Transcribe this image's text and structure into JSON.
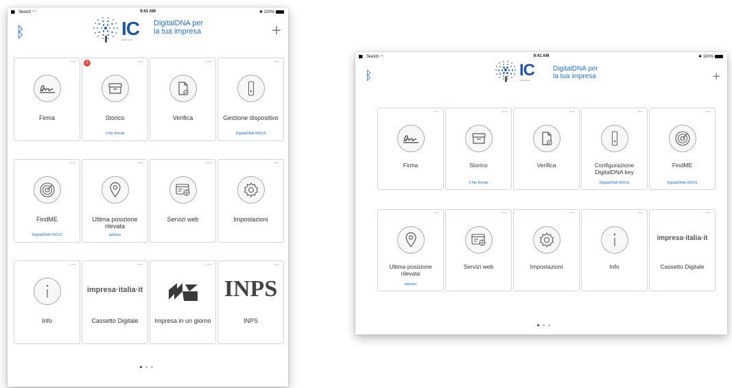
{
  "status_bar": {
    "carrier": "Sketch",
    "time": "9:41 AM",
    "battery": "100%"
  },
  "header": {
    "logo_text": "IC",
    "logo_sub": "InfoCamere",
    "tagline_line1": "DigitalDNA per",
    "tagline_line2": "la tua impresa"
  },
  "portrait": {
    "tiles": [
      {
        "label": "Firma",
        "icon": "signature-icon"
      },
      {
        "label": "Storico",
        "sub": "2 file firmati",
        "badge": "2",
        "icon": "archive-icon"
      },
      {
        "label": "Verifica",
        "icon": "document-check-icon"
      },
      {
        "label": "Gestione dispositivo",
        "sub": "DigitalDNA-00015",
        "icon": "usb-key-icon"
      },
      {
        "label": "FindME",
        "sub": "DigitalDNA-00015",
        "icon": "radar-icon"
      },
      {
        "label": "Ultima posizione rilevata",
        "sub": "adesso",
        "icon": "location-pin-icon"
      },
      {
        "label": "Servizi web",
        "icon": "browser-globe-icon"
      },
      {
        "label": "Impostazioni",
        "icon": "gear-icon"
      },
      {
        "label": "Info",
        "icon": "info-icon"
      },
      {
        "label": "Cassetto Digitale",
        "logo": "impresa·italia·it"
      },
      {
        "label": "Impresa in un giorno",
        "icon": "impresa-giorno-logo-icon"
      },
      {
        "label": "INPS",
        "logo": "INPS"
      }
    ]
  },
  "landscape": {
    "tiles": [
      {
        "label": "Firma",
        "icon": "signature-icon"
      },
      {
        "label": "Storico",
        "sub": "2 file firmati",
        "icon": "archive-icon"
      },
      {
        "label": "Verifica",
        "icon": "document-check-icon"
      },
      {
        "label": "Configurazione DigitalDNA key",
        "sub": "DigitalDNA-00015",
        "icon": "usb-key-icon"
      },
      {
        "label": "FindME",
        "sub": "DigitalDNA-00015",
        "icon": "radar-icon"
      },
      {
        "label": "Ultima posizione rilevata",
        "sub": "adesso",
        "icon": "location-pin-icon"
      },
      {
        "label": "Servizi web",
        "icon": "browser-globe-icon"
      },
      {
        "label": "Impostazioni",
        "icon": "gear-icon"
      },
      {
        "label": "Info",
        "icon": "info-icon"
      },
      {
        "label": "Cassetto Digitale",
        "logo": "impresa·italia·it"
      }
    ]
  },
  "pager": {
    "pages": 3,
    "active": 0
  },
  "colors": {
    "accent": "#1e6fd9",
    "logo_blue": "#1c56a8",
    "badge": "#e8463b",
    "tile_border": "#cfd6e2"
  }
}
